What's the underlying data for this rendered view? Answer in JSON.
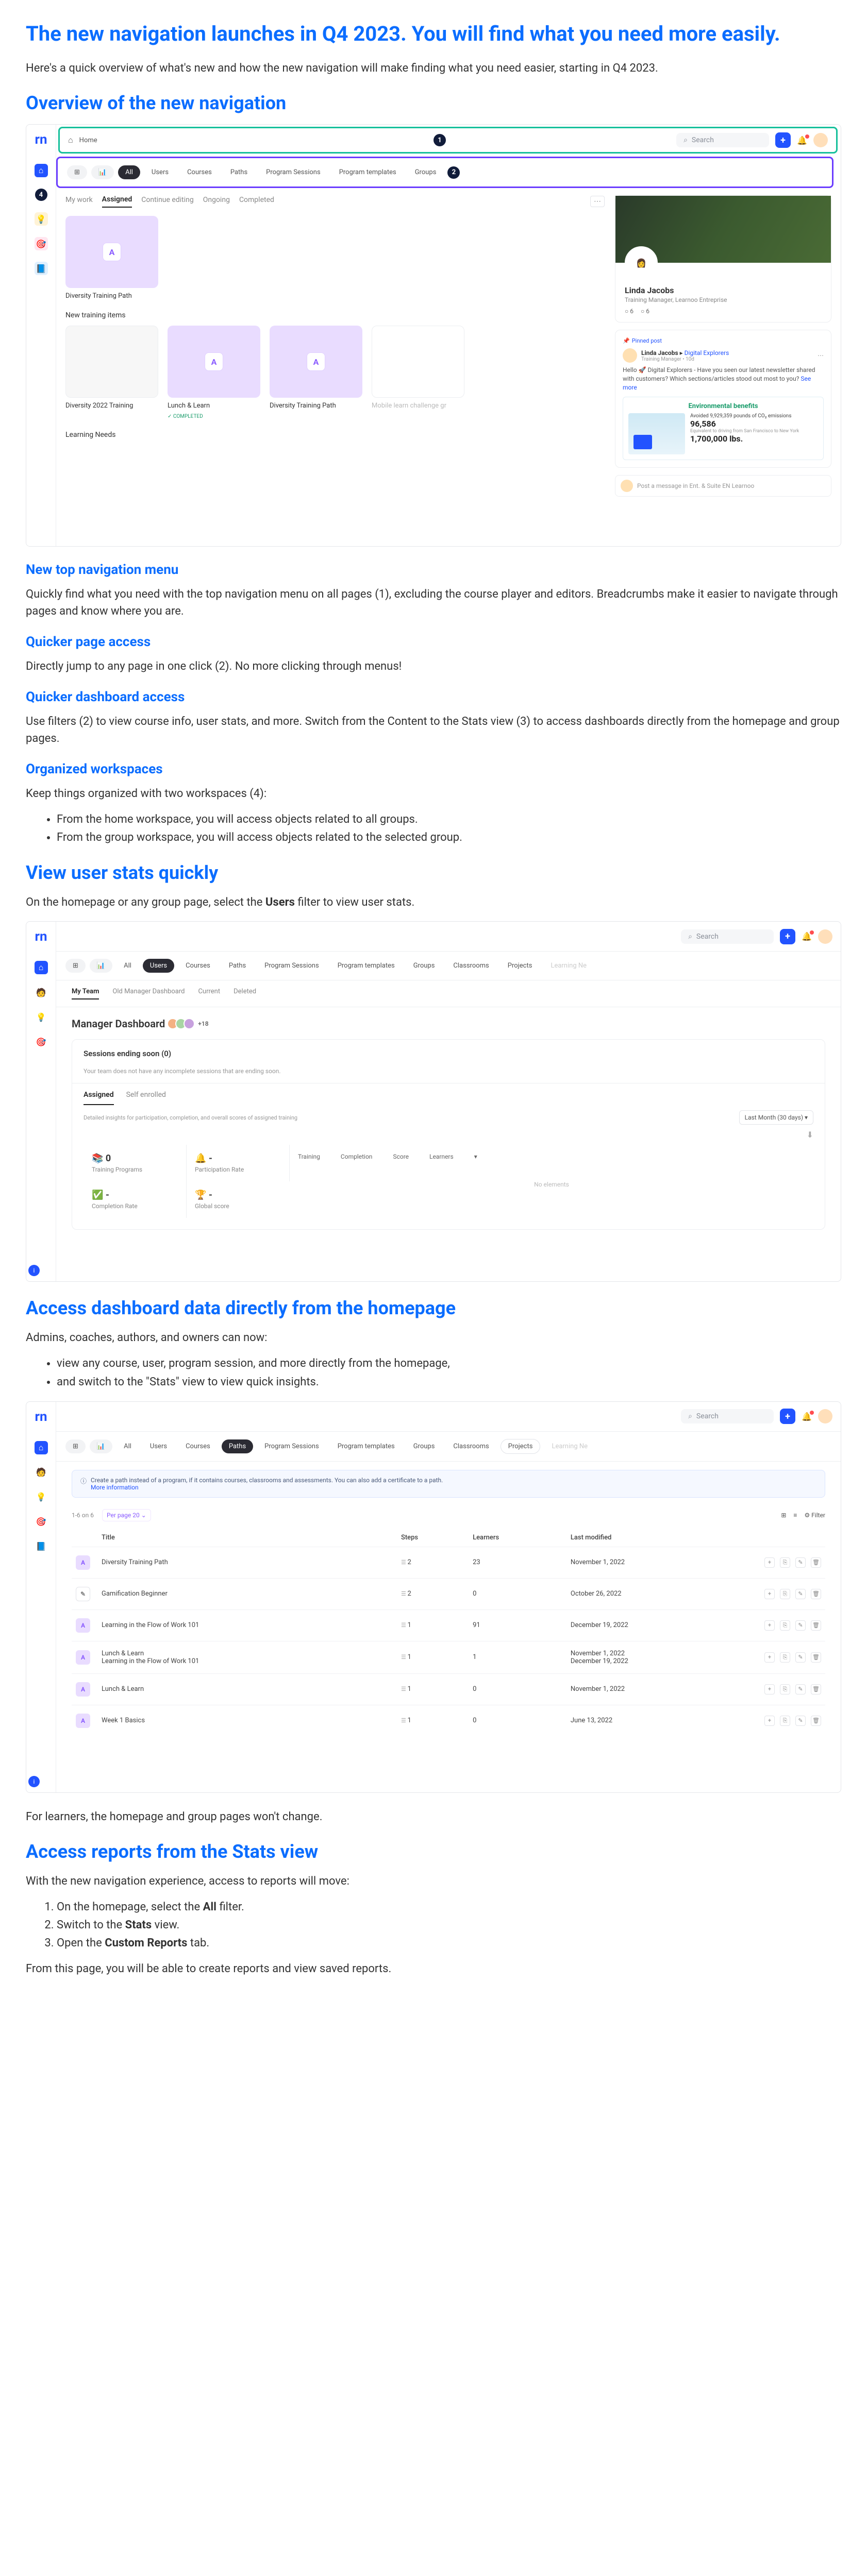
{
  "h1": "The new navigation launches in Q4 2023. You will find what you need more easily.",
  "intro": "Here's a quick overview of what's new and how the new navigation will make finding what you need easier, starting in Q4 2023.",
  "h2_overview": "Overview of the new navigation",
  "mock1": {
    "logo": "rn",
    "home_crumb": "Home",
    "search_placeholder": "Search",
    "filters": [
      "All",
      "Users",
      "Courses",
      "Paths",
      "Program Sessions",
      "Program templates",
      "Groups"
    ],
    "tabs": {
      "mywork": "My work",
      "assigned": "Assigned",
      "continue": "Continue editing",
      "ongoing": "Ongoing",
      "completed": "Completed"
    },
    "tile1": "Diversity Training Path",
    "section_new": "New training items",
    "tiles_new": [
      "Diversity 2022 Training",
      "Lunch & Learn",
      "Diversity Training Path",
      "Mobile learn challenge gr"
    ],
    "completed_badge": "COMPLETED",
    "section_needs": "Learning Needs",
    "profile_name": "Linda Jacobs",
    "profile_title": "Training Manager, Learnoo Entreprise",
    "stat1": "6",
    "stat2": "6",
    "pinned": "Pinned post",
    "post_name": "Linda Jacobs",
    "post_group": "Digital Explorers",
    "post_role": "Training Manager • 10d",
    "post_body": "Hello 🚀 Digital Explorers - Have you seen our latest newsletter shared with customers? Which sections/articles stood out most to you?",
    "see_more": "See more",
    "env_title": "Environmental benefits",
    "env_line1": "Avoided 9,929,359 pounds of CO₂ emissions",
    "env_stat1": "96,586",
    "env_stat2": "1,700,000 lbs.",
    "composer": "Post a message in Ent. & Suite EN Learnoo"
  },
  "h3_topnav": "New top navigation menu",
  "p_topnav": "Quickly find what you need with the top navigation menu on all pages (1), excluding the course player and editors. Breadcrumbs make it easier to navigate through pages and know where you are.",
  "h3_qpa": "Quicker page access",
  "p_qpa": "Directly jump to any page in one click (2). No more clicking through menus!",
  "h3_qda": "Quicker dashboard access",
  "p_qda": "Use filters (2) to view course info, user stats, and more. Switch from the Content to the Stats view (3) to access dashboards directly from the homepage and group pages.",
  "h3_org": "Organized workspaces",
  "p_org": "Keep things organized with two workspaces (4):",
  "org_li1": "From the home workspace, you will access objects related to all groups.",
  "org_li2": "From the group workspace, you will access objects related to the selected group.",
  "h2_stats": "View user stats quickly",
  "p_stats_pre": "On the homepage or any group page, select the ",
  "p_stats_bold": "Users",
  "p_stats_post": " filter to view user stats.",
  "mock2": {
    "filters": [
      "All",
      "Users",
      "Courses",
      "Paths",
      "Program Sessions",
      "Program templates",
      "Groups",
      "Classrooms",
      "Projects",
      "Learning Ne"
    ],
    "active_filter_idx": 1,
    "tabs": [
      "My Team",
      "Old Manager Dashboard",
      "Current",
      "Deleted"
    ],
    "title": "Manager Dashboard",
    "avatars_more": "+18",
    "panel_title": "Sessions ending soon (0)",
    "panel_sub": "Your team does not have any incomplete sessions that are ending soon.",
    "dp_tabs": [
      "Assigned",
      "Self enrolled"
    ],
    "dp_desc": "Detailed insights for participation, completion, and overall scores of assigned training",
    "period": "Last Month (30 days)",
    "metrics": [
      {
        "ico": "📚",
        "val": "0",
        "lab": "Training Programs"
      },
      {
        "ico": "🔔",
        "val": "-",
        "lab": "Participation Rate"
      },
      {
        "ico": "✅",
        "val": "-",
        "lab": "Completion Rate"
      },
      {
        "ico": "🏆",
        "val": "-",
        "lab": "Global score"
      }
    ],
    "th": [
      "Training",
      "Completion",
      "Score",
      "Learners"
    ],
    "noel": "No elements"
  },
  "h2_dash": "Access dashboard data directly from the homepage",
  "p_dash": "Admins, coaches, authors, and owners can now:",
  "dash_li1": "view any course, user, program session, and more directly from the homepage,",
  "dash_li2": "and switch to the \"Stats\" view to view quick insights.",
  "mock3": {
    "filters": [
      "All",
      "Users",
      "Courses",
      "Paths",
      "Program Sessions",
      "Program templates",
      "Groups",
      "Classrooms",
      "Projects",
      "Learning Ne"
    ],
    "active_filter_idx": 3,
    "banner": "Create a path instead of a program, if it contains courses, classrooms and assessments. You can also add a certificate to a path.",
    "banner_link": "More information",
    "results": "1-6 on 6",
    "perpage": "Per page 20",
    "tool_right": [
      "⊞",
      "≡",
      "⚙ Filter"
    ],
    "th": [
      "",
      "Title",
      "Steps",
      "Learners",
      "Last modified",
      ""
    ],
    "rows": [
      {
        "ico": "A",
        "title": "Diversity Training Path",
        "steps": "2",
        "learners": "23",
        "date": "November 1, 2022"
      },
      {
        "ico": "✎",
        "w": true,
        "title": "Gamification Beginner",
        "steps": "2",
        "learners": "0",
        "date": "October 26, 2022"
      },
      {
        "ico": "A",
        "title": "Learning in the Flow of Work 101",
        "steps": "1",
        "learners": "91",
        "date": "December 19, 2022"
      },
      {
        "ico": "A",
        "title": "Lunch & Learn\nLearning in the Flow of Work 101",
        "steps": "1",
        "learners": "1",
        "date": "November 1, 2022\nDecember 19, 2022"
      },
      {
        "ico": "A",
        "title": "Lunch & Learn",
        "steps": "1",
        "learners": "0",
        "date": "November 1, 2022"
      },
      {
        "ico": "A",
        "title": "Week 1 Basics",
        "steps": "1",
        "learners": "0",
        "date": "June 13, 2022"
      }
    ]
  },
  "p_learners": "For learners, the homepage and group pages won't change.",
  "h2_reports": "Access reports from the Stats view",
  "p_reports": "With the new navigation experience, access to reports will move:",
  "rep_li1_pre": "On the homepage, select the ",
  "rep_li1_b": "All",
  "rep_li1_post": " filter.",
  "rep_li2_pre": "Switch to the ",
  "rep_li2_b": "Stats",
  "rep_li2_post": " view.",
  "rep_li3_pre": "Open the ",
  "rep_li3_b": "Custom Reports",
  "rep_li3_post": " tab.",
  "p_reports_end": "From this page, you will be able to create reports and view saved reports."
}
